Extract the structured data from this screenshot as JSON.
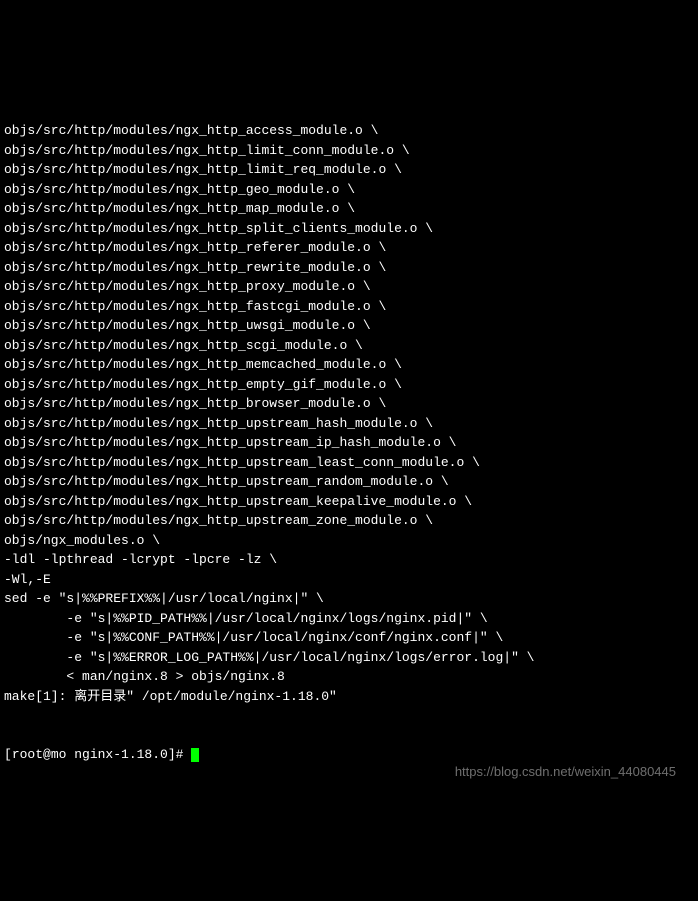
{
  "terminal": {
    "lines": [
      "objs/src/http/modules/ngx_http_access_module.o \\",
      "objs/src/http/modules/ngx_http_limit_conn_module.o \\",
      "objs/src/http/modules/ngx_http_limit_req_module.o \\",
      "objs/src/http/modules/ngx_http_geo_module.o \\",
      "objs/src/http/modules/ngx_http_map_module.o \\",
      "objs/src/http/modules/ngx_http_split_clients_module.o \\",
      "objs/src/http/modules/ngx_http_referer_module.o \\",
      "objs/src/http/modules/ngx_http_rewrite_module.o \\",
      "objs/src/http/modules/ngx_http_proxy_module.o \\",
      "objs/src/http/modules/ngx_http_fastcgi_module.o \\",
      "objs/src/http/modules/ngx_http_uwsgi_module.o \\",
      "objs/src/http/modules/ngx_http_scgi_module.o \\",
      "objs/src/http/modules/ngx_http_memcached_module.o \\",
      "objs/src/http/modules/ngx_http_empty_gif_module.o \\",
      "objs/src/http/modules/ngx_http_browser_module.o \\",
      "objs/src/http/modules/ngx_http_upstream_hash_module.o \\",
      "objs/src/http/modules/ngx_http_upstream_ip_hash_module.o \\",
      "objs/src/http/modules/ngx_http_upstream_least_conn_module.o \\",
      "objs/src/http/modules/ngx_http_upstream_random_module.o \\",
      "objs/src/http/modules/ngx_http_upstream_keepalive_module.o \\",
      "objs/src/http/modules/ngx_http_upstream_zone_module.o \\",
      "objs/ngx_modules.o \\",
      "-ldl -lpthread -lcrypt -lpcre -lz \\",
      "-Wl,-E",
      "sed -e \"s|%%PREFIX%%|/usr/local/nginx|\" \\",
      "        -e \"s|%%PID_PATH%%|/usr/local/nginx/logs/nginx.pid|\" \\",
      "        -e \"s|%%CONF_PATH%%|/usr/local/nginx/conf/nginx.conf|\" \\",
      "        -e \"s|%%ERROR_LOG_PATH%%|/usr/local/nginx/logs/error.log|\" \\",
      "        < man/nginx.8 > objs/nginx.8",
      "make[1]: 离开目录\" /opt/module/nginx-1.18.0\""
    ],
    "prompt": {
      "open": "[",
      "user_host": "root@mo nginx-1.18.0",
      "close": "]# "
    }
  },
  "watermark": "https://blog.csdn.net/weixin_44080445"
}
